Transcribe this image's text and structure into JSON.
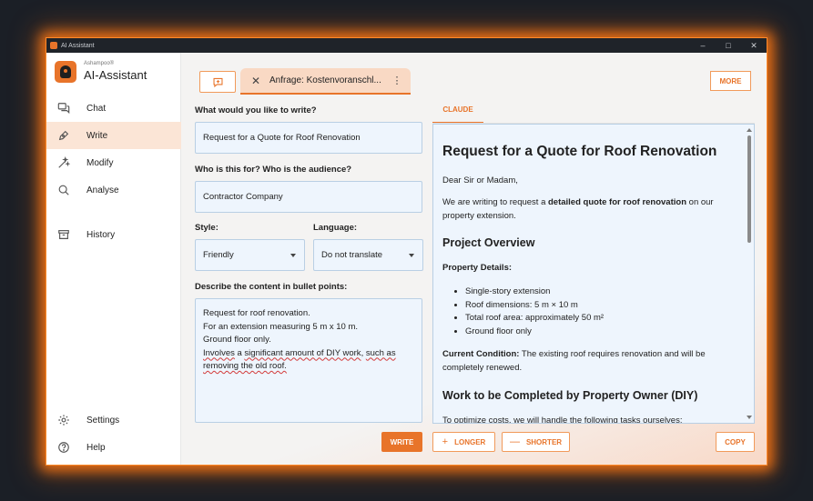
{
  "window": {
    "title": "AI Assistant",
    "minimize": "–",
    "maximize": "□",
    "close": "✕"
  },
  "brand": {
    "small": "Ashampoo®",
    "name": "AI-Assistant"
  },
  "sidebar": {
    "items": [
      {
        "label": "Chat",
        "icon": "chat-icon"
      },
      {
        "label": "Write",
        "icon": "pen-icon"
      },
      {
        "label": "Modify",
        "icon": "magic-wand-icon"
      },
      {
        "label": "Analyse",
        "icon": "search-icon"
      },
      {
        "label": "History",
        "icon": "archive-icon"
      }
    ],
    "bottom": [
      {
        "label": "Settings",
        "icon": "gear-icon"
      },
      {
        "label": "Help",
        "icon": "help-icon"
      }
    ],
    "active": "Write"
  },
  "tabs": {
    "current": "Anfrage: Kostenvoranschl...",
    "close": "✕",
    "menu": "⋮",
    "more": "MORE"
  },
  "form": {
    "what_label": "What would you like to write?",
    "what_value": "Request for a Quote for Roof Renovation",
    "audience_label": "Who is this for? Who is the audience?",
    "audience_value": "Contractor Company",
    "style_label": "Style:",
    "style_value": "Friendly",
    "language_label": "Language:",
    "language_value": "Do not translate",
    "content_label": "Describe the content in bullet points:",
    "content_lines": [
      "Request for roof renovation.",
      "For an extension measuring 5 m x 10 m.",
      "Ground floor only."
    ],
    "content_line4a": "Involves",
    "content_line4b": " a ",
    "content_line4c": "significant amount of DIY work",
    "content_line4d": ", ",
    "content_line4e": "such as",
    "content_line5": "removing the old roof."
  },
  "buttons": {
    "write": "WRITE",
    "longer": "LONGER",
    "shorter": "SHORTER",
    "copy": "COPY",
    "plus": "+",
    "minus": "—"
  },
  "output": {
    "tab": "CLAUDE",
    "title": "Request for a Quote for Roof Renovation",
    "greeting": "Dear Sir or Madam,",
    "intro_a": "We are writing to request a ",
    "intro_b": "detailed quote for roof renovation",
    "intro_c": " on our",
    "intro_d": "property extension.",
    "h_overview": "Project Overview",
    "details_label": "Property Details:",
    "details": [
      "Single-story extension",
      "Roof dimensions: 5 m × 10 m",
      "Total roof area: approximately 50 m²",
      "Ground floor only"
    ],
    "condition_label": "Current Condition:",
    "condition_a": " The existing roof requires renovation and will be",
    "condition_b": "completely renewed.",
    "h_work": "Work to be Completed by Property Owner (DIY)",
    "work_intro": "To optimize costs, we will handle the following tasks ourselves:"
  },
  "colors": {
    "accent": "#e8742a",
    "input_bg": "#eef5fd",
    "active_nav": "#fbe5d6"
  }
}
